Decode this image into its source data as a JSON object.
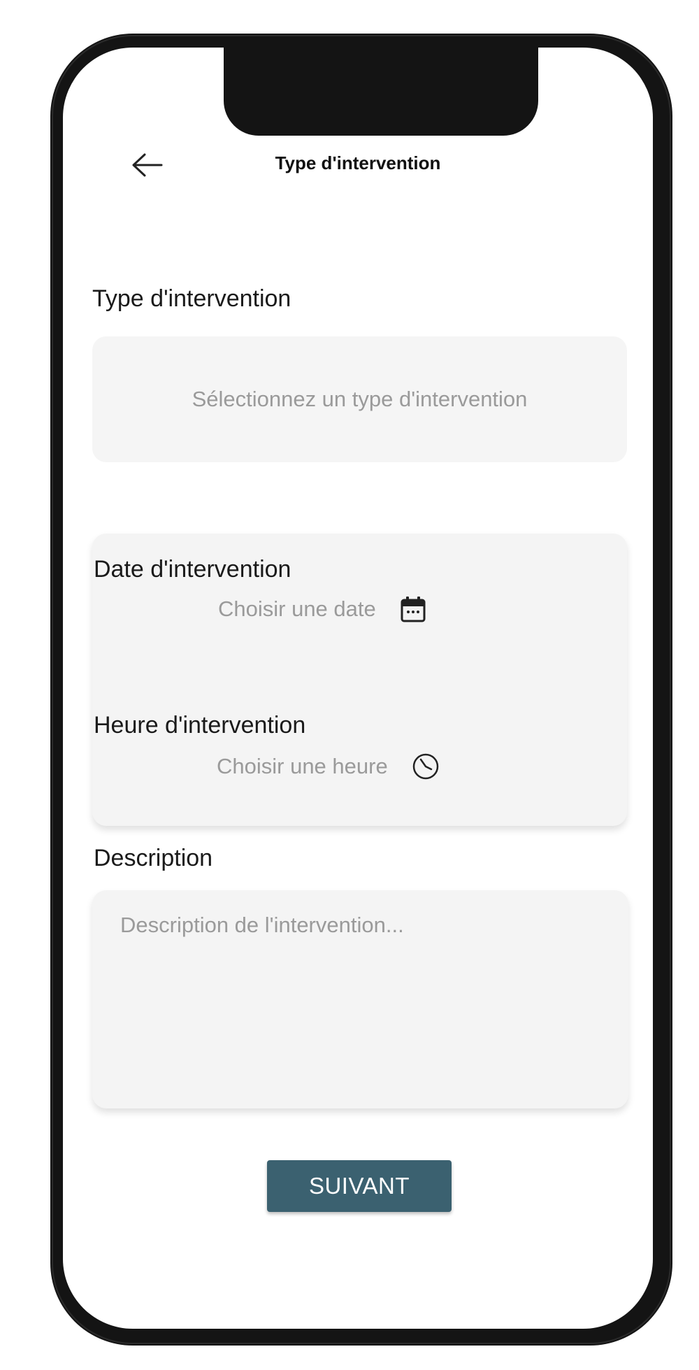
{
  "header": {
    "title": "Type d'intervention"
  },
  "form": {
    "type": {
      "label": "Type d'intervention",
      "placeholder": "Sélectionnez un type d'intervention"
    },
    "date": {
      "label": "Date d'intervention",
      "placeholder": "Choisir une date",
      "icon": "calendar-icon"
    },
    "time": {
      "label": "Heure d'intervention",
      "placeholder": "Choisir une heure",
      "icon": "clock-icon"
    },
    "description": {
      "label": "Description",
      "placeholder": "Description de l'intervention..."
    },
    "submit_label": "SUIVANT"
  },
  "colors": {
    "primary_button": "#3b6170",
    "field_background": "#f5f5f5",
    "placeholder_text": "#9a9a9a"
  }
}
